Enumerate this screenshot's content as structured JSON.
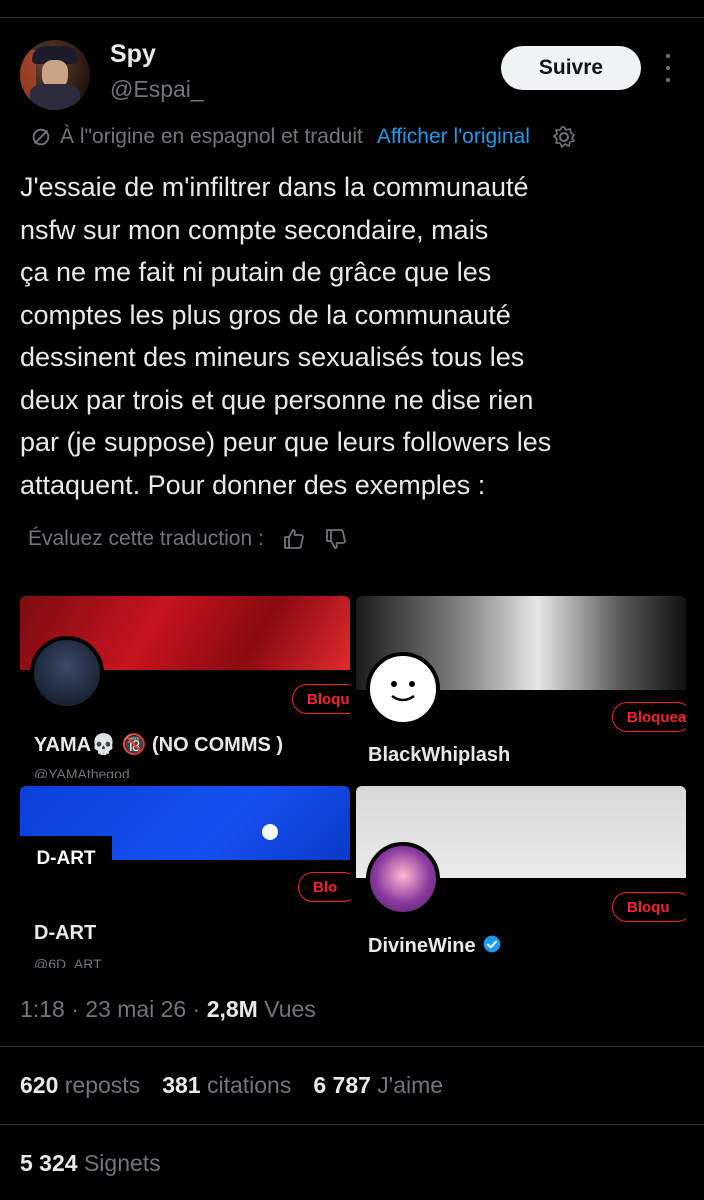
{
  "user": {
    "name": "Spy",
    "handle": "@Espai_"
  },
  "follow_label": "Suivre",
  "translation": {
    "notice": "À l\"origine en espagnol et traduit",
    "show_original": "Afficher l'original"
  },
  "tweet_text": "J'essaie de m'infiltrer dans la communauté\nnsfw sur mon compte secondaire, mais\nça ne me fait ni putain de grâce que les\ncomptes les plus gros de la communauté\ndessinent des mineurs sexualisés tous les\ndeux par trois et que personne ne dise rien\npar (je suppose) peur que leurs followers les\nattaquent. Pour donner des exemples :",
  "rate_translation": "Évaluez cette traduction :",
  "cards": [
    {
      "name": "YAMA💀 🔞 (NO COMMS )",
      "handle": "@YAMAthegod",
      "button": "Bloqu"
    },
    {
      "name": "BlackWhiplash",
      "button": "Bloquea"
    },
    {
      "name": "D-ART",
      "handle": "@6D_ART",
      "logo": "D-ART",
      "button": "Blo"
    },
    {
      "name": "DivineWine",
      "button": "Bloqu",
      "verified": true
    }
  ],
  "meta": {
    "time": "1:18",
    "date": "23 mai 26",
    "views_count": "2,8M",
    "views_label": "Vues"
  },
  "stats": {
    "reposts_count": "620",
    "reposts_label": "reposts",
    "quotes_count": "381",
    "quotes_label": "citations",
    "likes_count": "6 787",
    "likes_label": "J'aime"
  },
  "bookmarks": {
    "count": "5 324",
    "label": "Signets"
  },
  "colors": {
    "background": "#000000",
    "text": "#e7e9ea",
    "secondary": "#71767b",
    "link": "#1d9bf0",
    "block_red": "#f4212e"
  },
  "icons": [
    "more-icon",
    "translate-icon",
    "gear-icon",
    "thumbs-up-icon",
    "thumbs-down-icon",
    "verified-badge-icon"
  ]
}
